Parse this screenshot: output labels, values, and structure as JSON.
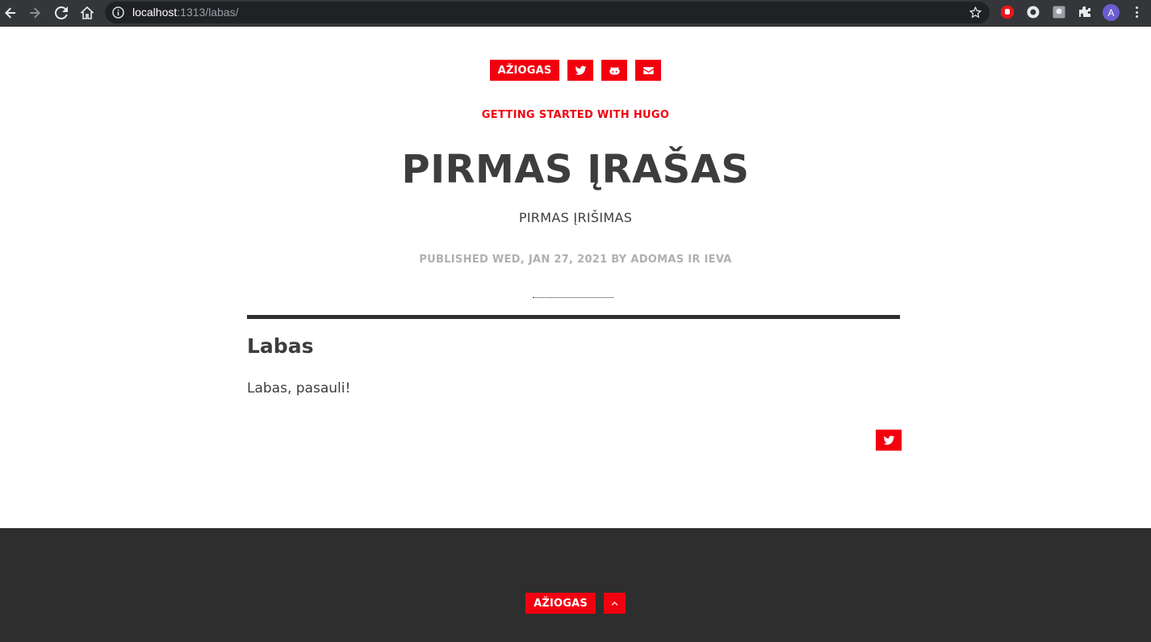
{
  "browser": {
    "url_host": "localhost",
    "url_rest": ":1313/labas/",
    "avatar_letter": "A",
    "icons": [
      "back-icon",
      "forward-icon",
      "reload-icon",
      "home-icon",
      "info-icon",
      "star-icon",
      "adblock-icon",
      "extension-circle-icon",
      "extension-square-icon",
      "puzzle-icon",
      "menu-icon"
    ]
  },
  "header": {
    "brand_label": "AŽIOGAS",
    "social_icons": [
      "twitter-icon",
      "github-icon",
      "email-icon"
    ]
  },
  "post": {
    "kicker": "GETTING STARTED WITH HUGO",
    "title": "PIRMAS ĮRAŠAS",
    "subtitle": "PIRMAS ĮRIŠIMAS",
    "meta": "PUBLISHED WED, JAN 27, 2021 BY ADOMAS IR IEVA",
    "heading": "Labas",
    "body": "Labas, pasauli!"
  },
  "footer": {
    "brand_label": "AŽIOGAS",
    "up_icon": "chevron-up-icon"
  },
  "colors": {
    "accent": "#f2000f",
    "text": "#3d3d3d",
    "meta": "#b0b0b0",
    "footer_bg": "#2e2e2e",
    "chrome_bg": "#35363a"
  }
}
